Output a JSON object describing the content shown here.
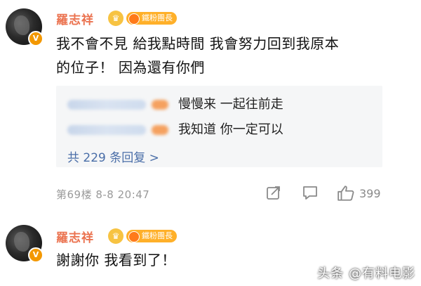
{
  "comments": [
    {
      "author": "羅志祥",
      "fan_badge": "鐵粉團長",
      "text_line1": "我不會不見 給我點時間 我會努力回到我原本",
      "text_line2": "的位子！ 因為還有你們",
      "replies": [
        {
          "text": "慢慢来 一起往前走"
        },
        {
          "text": "我知道 你一定可以"
        }
      ],
      "reply_count": "共 229 条回复 >",
      "meta": "第69楼 8-8 20:47",
      "like_count": "399"
    },
    {
      "author": "羅志祥",
      "fan_badge": "鐵粉團長",
      "text_line1": "謝謝你 我看到了！"
    }
  ],
  "watermark": "头条 @有料电影",
  "colors": {
    "name": "#eb7350",
    "reply_link": "#4a6ea8",
    "badge": "#ffb029",
    "meta": "#9a9a9a"
  },
  "icons": [
    "avatar-v-badge",
    "crown-icon",
    "fan-badge-icon",
    "share-icon",
    "comment-icon",
    "like-icon"
  ]
}
